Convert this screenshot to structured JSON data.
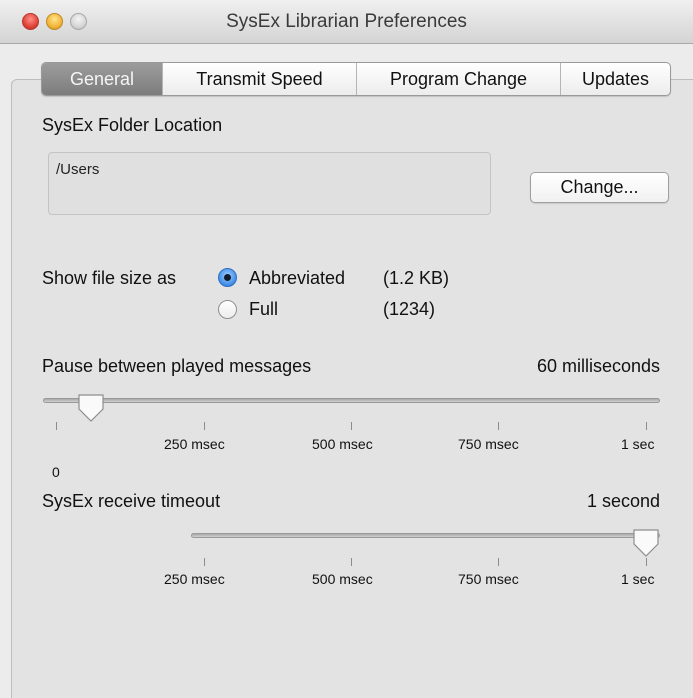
{
  "window": {
    "title": "SysEx Librarian Preferences"
  },
  "tabs": [
    {
      "label": "General",
      "active": true
    },
    {
      "label": "Transmit Speed",
      "active": false
    },
    {
      "label": "Program Change",
      "active": false
    },
    {
      "label": "Updates",
      "active": false
    }
  ],
  "general": {
    "folder_label": "SysEx Folder Location",
    "folder_path": "/Users",
    "change_button": "Change...",
    "file_size_label": "Show file size as",
    "file_size_options": [
      {
        "label": "Abbreviated",
        "example": "(1.2 KB)",
        "selected": true
      },
      {
        "label": "Full",
        "example": "(1234)",
        "selected": false
      }
    ],
    "pause_slider": {
      "label": "Pause between played messages",
      "value_text": "60 milliseconds",
      "value_ms": 60,
      "min_ms": 0,
      "max_ms": 1000,
      "min_label": "0",
      "ticks": [
        "250 msec",
        "500 msec",
        "750 msec",
        "1 sec"
      ]
    },
    "timeout_slider": {
      "label": "SysEx receive timeout",
      "value_text": "1 second",
      "value_ms": 1000,
      "min_ms": 0,
      "max_ms": 1000,
      "ticks": [
        "250 msec",
        "500 msec",
        "750 msec",
        "1 sec"
      ]
    }
  },
  "colors": {
    "selected_tab": "#8a8a8a",
    "radio_selected": "#3f8ce8",
    "window_background": "#ececec"
  }
}
